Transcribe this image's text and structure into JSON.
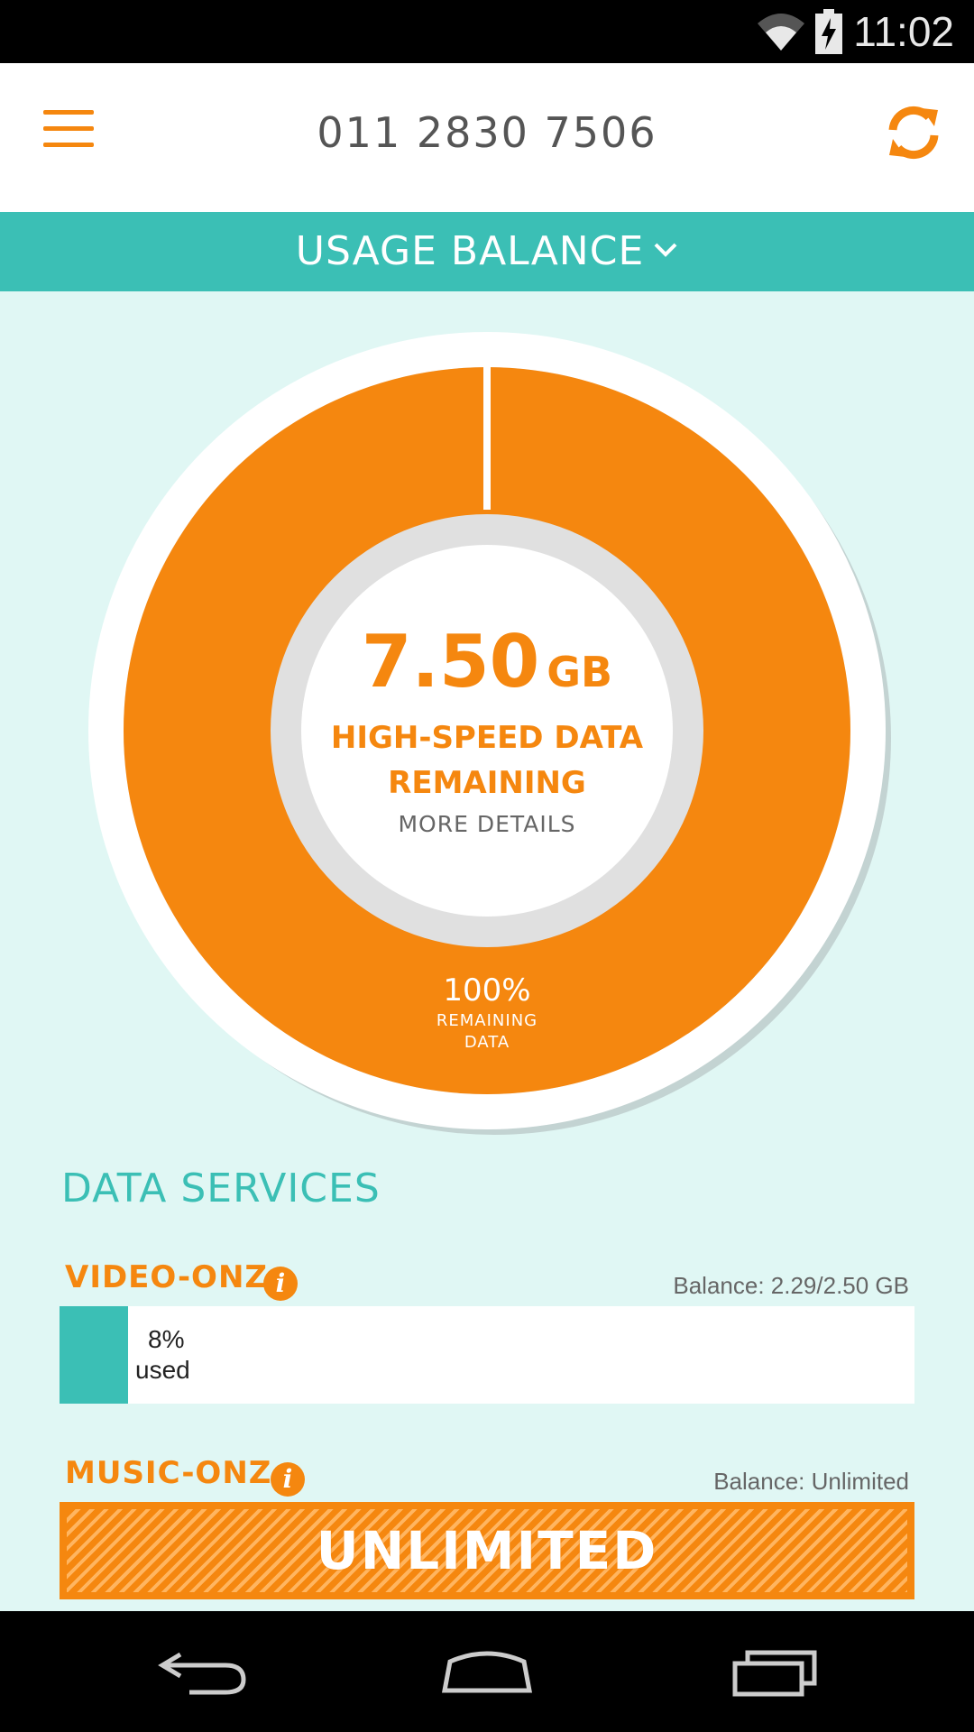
{
  "status_bar": {
    "time": "11:02",
    "wifi_icon": "wifi-icon",
    "battery_icon": "battery-charging-icon"
  },
  "app_bar": {
    "phone_number": "011 2830 7506",
    "menu_icon": "hamburger-menu-icon",
    "refresh_icon": "refresh-icon"
  },
  "usage_banner": {
    "label": "USAGE BALANCE",
    "icon": "chevron-down-icon"
  },
  "donut": {
    "remaining_fraction": 1.0,
    "amount": "7.50",
    "unit": "GB",
    "description_line1": "HIGH-SPEED DATA",
    "description_line2": "REMAINING",
    "more_details": "MORE DETAILS",
    "percent": "100%",
    "percent_label_line1": "REMAINING",
    "percent_label_line2": "DATA"
  },
  "data_services": {
    "title": "DATA SERVICES",
    "services": [
      {
        "name": "VIDEO-ONZ",
        "balance": "Balance: 2.29/2.50 GB",
        "used_fraction": 0.08,
        "used_pct": "8%",
        "used_label": "used"
      },
      {
        "name": "MUSIC-ONZ",
        "balance": "Balance: Unlimited",
        "unlimited_label": "UNLIMITED"
      }
    ],
    "info_glyph": "i"
  },
  "colors": {
    "accent": "#f5870f",
    "teal": "#3bbfb5",
    "background": "#e0f7f4"
  },
  "nav_bar": {
    "back_icon": "back-icon",
    "home_icon": "home-icon",
    "recents_icon": "recent-apps-icon"
  }
}
